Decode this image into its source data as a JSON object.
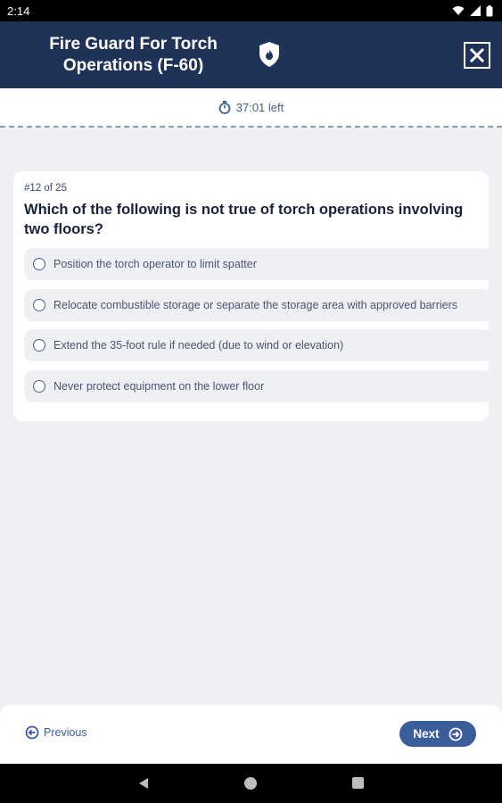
{
  "status_bar": {
    "time": "2:14"
  },
  "header": {
    "title": "Fire Guard For Torch Operations (F-60)",
    "shield_icon": "shield-flame-icon",
    "close_icon": "close-icon"
  },
  "timer": {
    "text": "37:01 left",
    "icon": "stopwatch-icon"
  },
  "question": {
    "counter": "#12 of 25",
    "text": "Which of the following is not true of torch operations involving two floors?",
    "options": [
      {
        "label": "Position the torch operator to limit spatter"
      },
      {
        "label": "Relocate combustible storage or separate the storage area with approved barriers"
      },
      {
        "label": "Extend the 35-foot rule if needed (due to wind or elevation)"
      },
      {
        "label": "Never protect equipment on the lower floor"
      }
    ]
  },
  "footer": {
    "previous_label": "Previous",
    "next_label": "Next"
  },
  "colors": {
    "header_bg": "#1f3358",
    "accent": "#3a5d9c",
    "page_bg": "#eef0f4"
  }
}
